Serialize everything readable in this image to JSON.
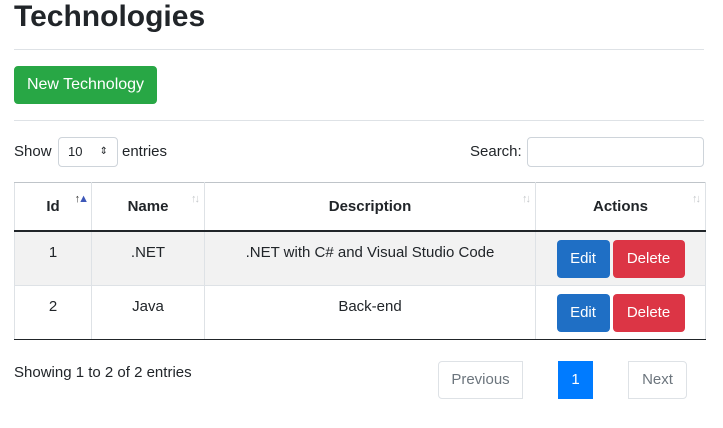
{
  "page": {
    "title": "Technologies"
  },
  "toolbar": {
    "new_label": "New Technology"
  },
  "length": {
    "show_label": "Show",
    "selected": "10",
    "entries_label": "entries"
  },
  "search": {
    "label": "Search:",
    "value": ""
  },
  "table": {
    "columns": [
      "Id",
      "Name",
      "Description",
      "Actions"
    ],
    "rows": [
      {
        "id": "1",
        "name": ".NET",
        "description": ".NET with C# and Visual Studio Code",
        "edit": "Edit",
        "delete": "Delete"
      },
      {
        "id": "2",
        "name": "Java",
        "description": "Back-end",
        "edit": "Edit",
        "delete": "Delete"
      }
    ]
  },
  "info": "Showing 1 to 2 of 2 entries",
  "pagination": {
    "previous": "Previous",
    "current": "1",
    "next": "Next"
  },
  "colors": {
    "success": "#28a745",
    "primary": "#007bff",
    "edit": "#1f6fc5",
    "danger": "#dc3545"
  }
}
